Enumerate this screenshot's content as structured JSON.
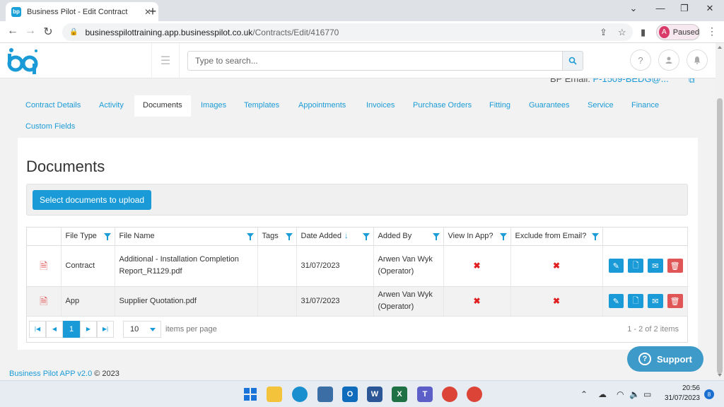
{
  "browser": {
    "tab_title": "Business Pilot - Edit Contract",
    "tab_favicon": "bp",
    "new_tab": "+",
    "url_host": "businesspilottraining.app.businesspilot.co.uk",
    "url_path": "/Contracts/Edit/416770",
    "profile_initial": "A",
    "profile_status": "Paused"
  },
  "header": {
    "search_placeholder": "Type to search..."
  },
  "contract": {
    "bp_email_label": "BP Email:",
    "bp_email_value": "P-1509-BEDG@..."
  },
  "tabs": [
    {
      "label": "Contract Details"
    },
    {
      "label": "Activity"
    },
    {
      "label": "Documents"
    },
    {
      "label": "Images"
    },
    {
      "label": "Templates"
    },
    {
      "label": "Appointments"
    },
    {
      "label": "Invoices"
    },
    {
      "label": "Purchase Orders"
    },
    {
      "label": "Fitting"
    },
    {
      "label": "Guarantees"
    },
    {
      "label": "Service"
    },
    {
      "label": "Finance"
    },
    {
      "label": "Custom Fields"
    }
  ],
  "documents": {
    "title": "Documents",
    "upload_label": "Select documents to upload",
    "columns": [
      "File Type",
      "File Name",
      "Tags",
      "Date Added",
      "Added By",
      "View In App?",
      "Exclude from Email?"
    ],
    "rows": [
      {
        "file_type": "Contract",
        "file_name": "Additional - Installation Completion Report_R1129.pdf",
        "tags": "",
        "date_added": "31/07/2023",
        "added_by": "Arwen Van Wyk (Operator)",
        "view_in_app": "✖",
        "exclude_email": "✖"
      },
      {
        "file_type": "App",
        "file_name": "Supplier Quotation.pdf",
        "tags": "",
        "date_added": "31/07/2023",
        "added_by": "Arwen Van Wyk (Operator)",
        "view_in_app": "✖",
        "exclude_email": "✖"
      }
    ],
    "pager": {
      "current_page": "1",
      "page_size": "10",
      "page_size_label": "items per page",
      "info": "1 - 2 of 2 items"
    }
  },
  "footer": {
    "version": "Business Pilot APP v2.0",
    "copyright": "© 2023"
  },
  "support": {
    "label": "Support"
  },
  "taskbar": {
    "time": "20:56",
    "date": "31/07/2023",
    "notifications": "8"
  },
  "colors": {
    "accent": "#1a9bd7",
    "danger": "#e05555",
    "support": "#3d9ac9"
  }
}
